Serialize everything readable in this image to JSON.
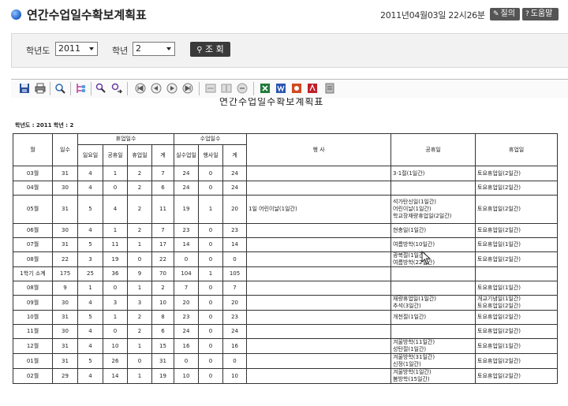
{
  "page": {
    "title": "연간수업일수확보계획표",
    "datetime": "2011년04월03일 22시26분",
    "buttons": [
      {
        "label": "질의",
        "icon": "pencil-icon"
      },
      {
        "label": "도움말",
        "icon": "help-icon"
      }
    ]
  },
  "search": {
    "year_label": "학년도",
    "year_value": "2011",
    "grade_label": "학년",
    "grade_value": "2",
    "query_label": "조 회"
  },
  "toolbar_icons": [
    "save-icon",
    "print-icon",
    "zoom-icon",
    "tree-icon",
    "find-icon",
    "find-next-icon",
    "first-page-icon",
    "prev-page-icon",
    "next-page-icon",
    "last-page-icon",
    "fit-width-icon",
    "fit-page-icon",
    "zoom-out-icon",
    "excel-icon",
    "word-icon",
    "hwp-icon",
    "pdf-icon",
    "export-icon"
  ],
  "report": {
    "title": "연간수업일수확보계획표",
    "info": "학년도 : 2011   학년 : 2",
    "headers": {
      "month": "월",
      "days": "일수",
      "holidays_group": "휴업일수",
      "sunday": "일요일",
      "public_holiday": "공휴일",
      "school_holiday": "휴업일",
      "holiday_total": "계",
      "class_group": "수업일수",
      "class_days": "실수업일",
      "event": "행사일",
      "class_total": "계",
      "events": "행  사",
      "public_holidays": "공휴일",
      "school_holidays": "휴업일"
    },
    "rows": [
      {
        "month": "03월",
        "days": "31",
        "sun": "4",
        "pub": "1",
        "sch": "2",
        "htot": "7",
        "cls": "24",
        "evt": "0",
        "ctot": "24",
        "events": [],
        "pubs": [
          "3·1절(1일간)"
        ],
        "schs": [
          "토요휴업일(2일간)"
        ]
      },
      {
        "month": "04월",
        "days": "30",
        "sun": "4",
        "pub": "0",
        "sch": "2",
        "htot": "6",
        "cls": "24",
        "evt": "0",
        "ctot": "24",
        "events": [],
        "pubs": [],
        "schs": [
          "토요휴업일(2일간)"
        ]
      },
      {
        "month": "05월",
        "days": "31",
        "sun": "5",
        "pub": "4",
        "sch": "2",
        "htot": "11",
        "cls": "19",
        "evt": "1",
        "ctot": "20",
        "events": [
          "1일 어린이날(1일간)"
        ],
        "pubs": [
          "석가탄신일(1일간)",
          "어린이날(1일간)",
          "학교장재량휴업일(2일간)"
        ],
        "schs": [
          "토요휴업일(2일간)"
        ]
      },
      {
        "month": "06월",
        "days": "30",
        "sun": "4",
        "pub": "1",
        "sch": "2",
        "htot": "7",
        "cls": "23",
        "evt": "0",
        "ctot": "23",
        "events": [],
        "pubs": [
          "현충일(1일간)"
        ],
        "schs": [
          "토요휴업일(2일간)"
        ]
      },
      {
        "month": "07월",
        "days": "31",
        "sun": "5",
        "pub": "11",
        "sch": "1",
        "htot": "17",
        "cls": "14",
        "evt": "0",
        "ctot": "14",
        "events": [],
        "pubs": [
          "여름방학(10일간)"
        ],
        "schs": [
          "토요휴업일(1일간)"
        ]
      },
      {
        "month": "08월",
        "days": "22",
        "sun": "3",
        "pub": "19",
        "sch": "0",
        "htot": "22",
        "cls": "0",
        "evt": "0",
        "ctot": "0",
        "events": [],
        "pubs": [
          "광복절(1일간)",
          "여름방학(22일간)"
        ],
        "schs": [
          "토요휴업일(2일간)"
        ]
      },
      {
        "month": "1학기 소계",
        "days": "175",
        "sun": "25",
        "pub": "36",
        "sch": "9",
        "htot": "70",
        "cls": "104",
        "evt": "1",
        "ctot": "105",
        "events": [],
        "pubs": [],
        "schs": []
      },
      {
        "month": "08월",
        "days": "9",
        "sun": "1",
        "pub": "0",
        "sch": "1",
        "htot": "2",
        "cls": "7",
        "evt": "0",
        "ctot": "7",
        "events": [],
        "pubs": [],
        "schs": [
          "토요휴업일(1일간)"
        ]
      },
      {
        "month": "09월",
        "days": "30",
        "sun": "4",
        "pub": "3",
        "sch": "3",
        "htot": "10",
        "cls": "20",
        "evt": "0",
        "ctot": "20",
        "events": [],
        "pubs": [
          "재량휴업일(1일간)",
          "추석(3일간)"
        ],
        "schs": [
          "개교기념일(1일간)",
          "토요휴업일(2일간)"
        ]
      },
      {
        "month": "10월",
        "days": "31",
        "sun": "5",
        "pub": "1",
        "sch": "2",
        "htot": "8",
        "cls": "23",
        "evt": "0",
        "ctot": "23",
        "events": [],
        "pubs": [
          "개천절(1일간)"
        ],
        "schs": [
          "토요휴업일(2일간)"
        ]
      },
      {
        "month": "11월",
        "days": "30",
        "sun": "4",
        "pub": "0",
        "sch": "2",
        "htot": "6",
        "cls": "24",
        "evt": "0",
        "ctot": "24",
        "events": [],
        "pubs": [],
        "schs": [
          "토요휴업일(2일간)"
        ]
      },
      {
        "month": "12월",
        "days": "31",
        "sun": "4",
        "pub": "10",
        "sch": "1",
        "htot": "15",
        "cls": "16",
        "evt": "0",
        "ctot": "16",
        "events": [],
        "pubs": [
          "겨울방학(11일간)",
          "성탄절(1일간)"
        ],
        "schs": [
          "토요휴업일(1일간)"
        ]
      },
      {
        "month": "01월",
        "days": "31",
        "sun": "5",
        "pub": "26",
        "sch": "0",
        "htot": "31",
        "cls": "0",
        "evt": "0",
        "ctot": "0",
        "events": [],
        "pubs": [
          "겨울방학(31일간)",
          "신정(1일간)"
        ],
        "schs": [
          "토요휴업일(2일간)"
        ]
      },
      {
        "month": "02월",
        "days": "29",
        "sun": "4",
        "pub": "14",
        "sch": "1",
        "htot": "19",
        "cls": "10",
        "evt": "0",
        "ctot": "10",
        "events": [],
        "pubs": [
          "겨울방학(1일간)",
          "봄방학(15일간)"
        ],
        "schs": [
          "토요휴업일(2일간)"
        ]
      }
    ]
  }
}
